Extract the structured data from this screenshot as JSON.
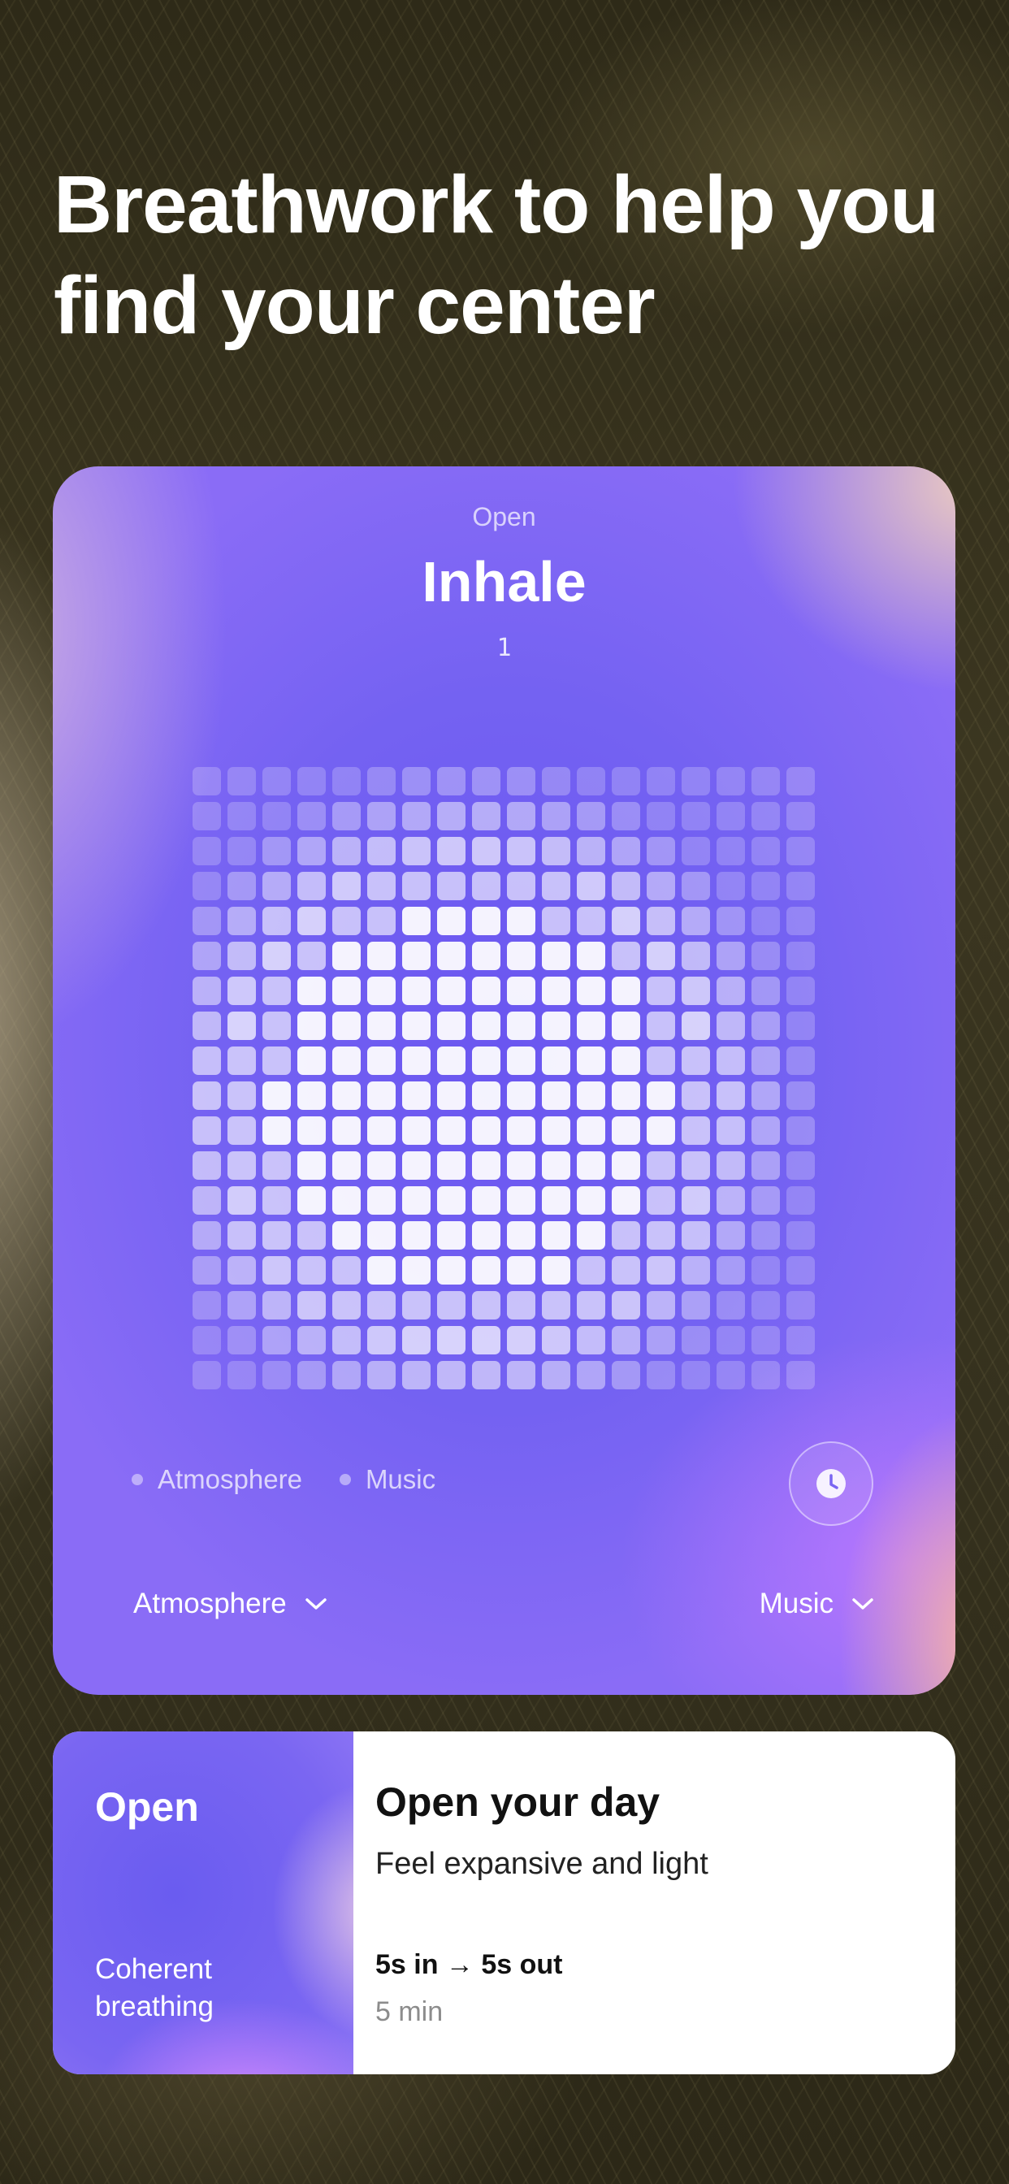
{
  "headline": "Breathwork to help you find your center",
  "player": {
    "phase_label": "Open",
    "phase_title": "Inhale",
    "count": "1",
    "legend": [
      {
        "label": "Atmosphere"
      },
      {
        "label": "Music"
      }
    ],
    "timer_icon": "clock-icon",
    "controls": {
      "atmosphere": {
        "label": "Atmosphere",
        "icon": "chevron-down-icon"
      },
      "music": {
        "label": "Music",
        "icon": "chevron-down-icon"
      }
    },
    "grid": {
      "columns": 18,
      "rows": 18,
      "accent": "#6a56f0"
    }
  },
  "session": {
    "thumbnail": {
      "title": "Open",
      "subtitle": "Coherent breathing"
    },
    "title": "Open your day",
    "subtitle": "Feel expansive and light",
    "pattern": "5s in → 5s out",
    "duration": "5 min"
  }
}
